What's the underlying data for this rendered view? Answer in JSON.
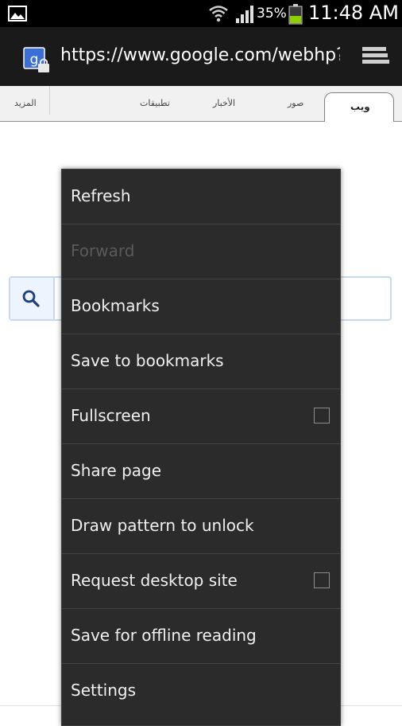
{
  "status_bar": {
    "battery_percent": "35%",
    "time": "11:48 AM",
    "icons": [
      "gallery-icon",
      "wifi-icon",
      "signal-icon",
      "battery-icon"
    ],
    "battery_color": "#8fce00"
  },
  "url_bar": {
    "url": "https://www.google.com/webhp?cli",
    "icons": [
      "google-lock-icon",
      "tabs-icon"
    ]
  },
  "tabs": {
    "web": "ويب",
    "images": "صور",
    "news": "الأخبار",
    "apps": "تطبيقات",
    "more": "المزيد"
  },
  "menu": {
    "items": [
      {
        "label": "Refresh",
        "enabled": true,
        "checkbox": false
      },
      {
        "label": "Forward",
        "enabled": false,
        "checkbox": false
      },
      {
        "label": "Bookmarks",
        "enabled": true,
        "checkbox": false
      },
      {
        "label": "Save to bookmarks",
        "enabled": true,
        "checkbox": false
      },
      {
        "label": "Fullscreen",
        "enabled": true,
        "checkbox": true,
        "checked": false
      },
      {
        "label": "Share page",
        "enabled": true,
        "checkbox": false
      },
      {
        "label": "Draw pattern to unlock",
        "enabled": true,
        "checkbox": false
      },
      {
        "label": "Request desktop site",
        "enabled": true,
        "checkbox": true,
        "checked": false
      },
      {
        "label": "Save for offline reading",
        "enabled": true,
        "checkbox": false
      },
      {
        "label": "Settings",
        "enabled": true,
        "checkbox": false
      }
    ]
  },
  "colors": {
    "menu_bg": "#2b2b2b",
    "menu_text": "#f0f0f0",
    "disabled_text": "#5a5a5a",
    "search_border": "#c5daf2"
  }
}
